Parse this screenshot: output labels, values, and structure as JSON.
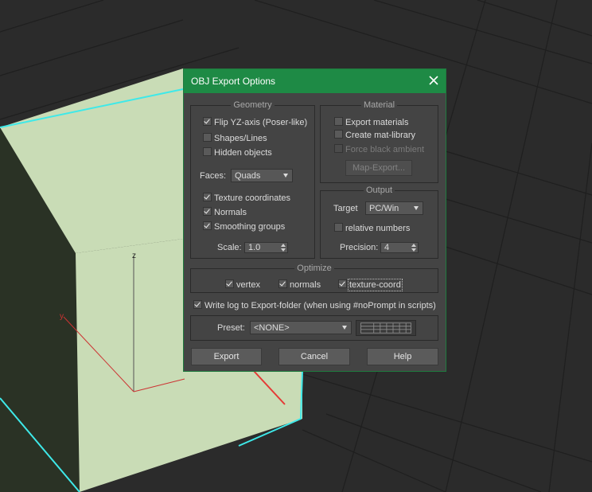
{
  "dialog": {
    "title": "OBJ Export Options",
    "close_icon": "close-icon",
    "accent_color": "#1e8a45"
  },
  "geometry": {
    "title": "Geometry",
    "flip_yz": {
      "label": "Flip YZ-axis (Poser-like)",
      "checked": true
    },
    "shapes_lines": {
      "label": "Shapes/Lines",
      "checked": false
    },
    "hidden_objects": {
      "label": "Hidden objects",
      "checked": false
    },
    "faces_label": "Faces:",
    "faces_value": "Quads",
    "texture_coordinates": {
      "label": "Texture coordinates",
      "checked": true
    },
    "normals": {
      "label": "Normals",
      "checked": true
    },
    "smoothing_groups": {
      "label": "Smoothing groups",
      "checked": true
    },
    "scale_label": "Scale:",
    "scale_value": "1.0"
  },
  "material": {
    "title": "Material",
    "export_materials": {
      "label": "Export materials",
      "checked": false
    },
    "create_mat_library": {
      "label": "Create mat-library",
      "checked": false
    },
    "force_black_ambient": {
      "label": "Force black ambient",
      "checked": false,
      "enabled": false
    },
    "map_export_label": "Map-Export..."
  },
  "output": {
    "title": "Output",
    "target_label": "Target",
    "target_value": "PC/Win",
    "relative_numbers": {
      "label": "relative numbers",
      "checked": false
    },
    "precision_label": "Precision:",
    "precision_value": "4"
  },
  "optimize": {
    "title": "Optimize",
    "vertex": {
      "label": "vertex",
      "checked": true
    },
    "normals": {
      "label": "normals",
      "checked": true
    },
    "texture_coord": {
      "label": "texture-coord",
      "checked": true
    }
  },
  "write_log": {
    "label": "Write log to Export-folder (when using #noPrompt in scripts)",
    "checked": true
  },
  "preset": {
    "label": "Preset:",
    "value": "<NONE>",
    "icon": "preset-manager-icon"
  },
  "buttons": {
    "export": "Export",
    "cancel": "Cancel",
    "help": "Help"
  },
  "viewport": {
    "cube_color": "#c9dcb6",
    "selection_color": "#3ee9e9",
    "axis_label_z": "z",
    "axis_label_y": "y"
  }
}
